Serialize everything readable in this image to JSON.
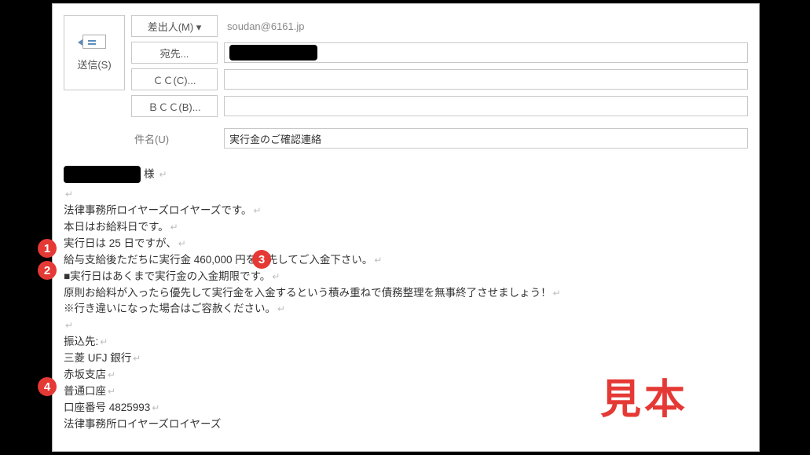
{
  "send": {
    "label": "送信(S)"
  },
  "fields": {
    "from_btn": "差出人(M) ▾",
    "from_value": "soudan@6161.jp",
    "to_btn": "宛先...",
    "cc_btn": "ＣＣ(C)...",
    "bcc_btn": "ＢＣＣ(B)...",
    "subject_label": "件名(U)",
    "subject_value": "実行金のご確認連絡"
  },
  "body": {
    "honorific": "様",
    "lines": [
      "法律事務所ロイヤーズロイヤーズです。",
      "本日はお給料日です。",
      "実行日は 25 日ですが、",
      "給与支給後ただちに実行金 460,000 円を優先してご入金下さい。",
      "■実行日はあくまで実行金の入金期限です。",
      "原則お給料が入ったら優先して実行金を入金するという積み重ねで債務整理を無事終了させましょう！",
      "※行き違いになった場合はご容赦ください。"
    ],
    "bank_label": "振込先:",
    "bank": [
      "三菱 UFJ 銀行",
      "赤坂支店",
      "普通口座",
      "口座番号 4825993",
      "法律事務所ロイヤーズロイヤーズ"
    ]
  },
  "watermark": "見本",
  "callouts": {
    "1": "1",
    "2": "2",
    "3": "3",
    "4": "4"
  }
}
